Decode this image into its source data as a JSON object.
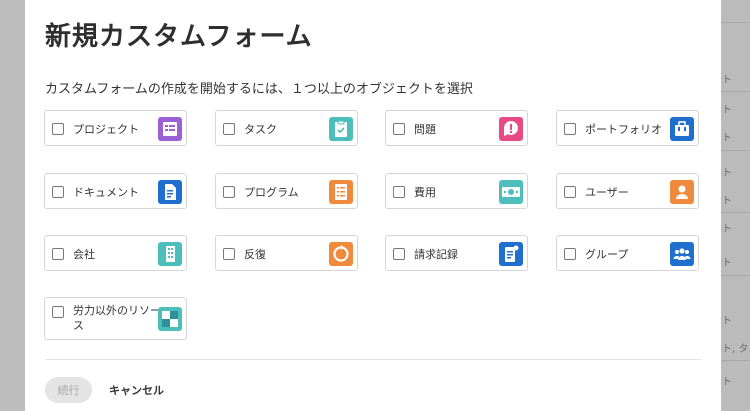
{
  "dialog": {
    "title": "新規カスタムフォーム",
    "subtitle": "カスタムフォームの作成を開始するには、１つ以上のオブジェクトを選択",
    "continue_label": "続行",
    "cancel_label": "キャンセル"
  },
  "object_types": [
    {
      "label": "プロジェクト",
      "icon": "project-icon",
      "color": "#9b5fd6",
      "checked": false
    },
    {
      "label": "タスク",
      "icon": "task-icon",
      "color": "#4cbfbc",
      "checked": false
    },
    {
      "label": "問題",
      "icon": "issue-icon",
      "color": "#e84a87",
      "checked": false
    },
    {
      "label": "ポートフォリオ",
      "icon": "portfolio-icon",
      "color": "#1f6fce",
      "checked": false
    },
    {
      "label": "ドキュメント",
      "icon": "document-icon",
      "color": "#1f6fce",
      "checked": false
    },
    {
      "label": "プログラム",
      "icon": "program-icon",
      "color": "#f08a3c",
      "checked": false
    },
    {
      "label": "費用",
      "icon": "expense-icon",
      "color": "#4cbfbc",
      "checked": false
    },
    {
      "label": "ユーザー",
      "icon": "user-icon",
      "color": "#f08a3c",
      "checked": false
    },
    {
      "label": "会社",
      "icon": "company-icon",
      "color": "#4cbfbc",
      "checked": false
    },
    {
      "label": "反復",
      "icon": "iteration-icon",
      "color": "#f08a3c",
      "checked": false
    },
    {
      "label": "請求記録",
      "icon": "billing-record-icon",
      "color": "#1f6fce",
      "checked": false
    },
    {
      "label": "グループ",
      "icon": "group-icon",
      "color": "#1f6fce",
      "checked": false
    },
    {
      "label": "労力以外のリソース",
      "icon": "non-labor-resource-icon",
      "color": "#4cbfbc",
      "checked": false
    }
  ],
  "background_fragments": [
    "ト",
    "ト",
    "ト",
    "ト",
    "ト",
    "ト",
    "ト",
    "ト",
    "ト, タス",
    "ト"
  ]
}
